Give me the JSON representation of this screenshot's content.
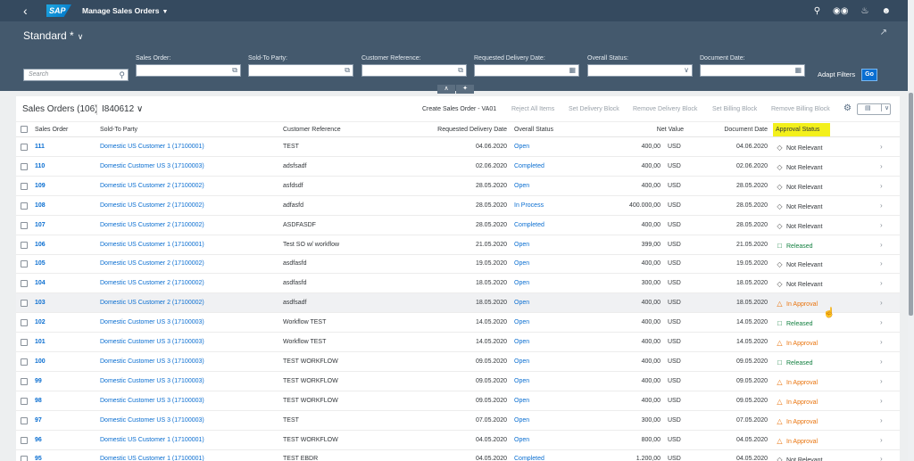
{
  "shell": {
    "logo": "SAP",
    "app_title": "Manage Sales Orders",
    "icons": [
      "search-icon",
      "binoculars-icon",
      "bell-icon",
      "user-icon"
    ]
  },
  "header": {
    "variant": "Standard *",
    "search_placeholder": "Search",
    "filters": [
      {
        "label": "Sales Order:"
      },
      {
        "label": "Sold-To Party:"
      },
      {
        "label": "Customer Reference:"
      },
      {
        "label": "Requested Delivery Date:"
      },
      {
        "label": "Overall Status:"
      },
      {
        "label": "Document Date:"
      }
    ],
    "adapt_filters": "Adapt Filters",
    "go": "Go"
  },
  "table": {
    "title": "Sales Orders (106)",
    "variant": "I840612",
    "actions": [
      {
        "label": "Create Sales Order - VA01",
        "enabled": true
      },
      {
        "label": "Reject All Items",
        "enabled": false
      },
      {
        "label": "Set Delivery Block",
        "enabled": false
      },
      {
        "label": "Remove Delivery Block",
        "enabled": false
      },
      {
        "label": "Set Billing Block",
        "enabled": false
      },
      {
        "label": "Remove Billing Block",
        "enabled": false
      }
    ],
    "columns": {
      "sales_order": "Sales Order",
      "sold_to": "Sold-To Party",
      "cust_ref": "Customer Reference",
      "req_date": "Requested Delivery Date",
      "overall": "Overall Status",
      "net_value": "Net Value",
      "doc_date": "Document Date",
      "approval": "Approval Status"
    },
    "rows": [
      {
        "so": "111",
        "party": "Domestic US Customer 1 (17100001)",
        "ref": "TEST",
        "req": "04.06.2020",
        "overall": "Open",
        "net": "400,00",
        "cur": "USD",
        "doc": "04.06.2020",
        "approval": "Not Relevant",
        "atype": "nr"
      },
      {
        "so": "110",
        "party": "Domestic Customer US 3 (17100003)",
        "ref": "adsfsadf",
        "req": "02.06.2020",
        "overall": "Completed",
        "net": "400,00",
        "cur": "USD",
        "doc": "02.06.2020",
        "approval": "Not Relevant",
        "atype": "nr"
      },
      {
        "so": "109",
        "party": "Domestic US Customer 2 (17100002)",
        "ref": "asfdsdf",
        "req": "28.05.2020",
        "overall": "Open",
        "net": "400,00",
        "cur": "USD",
        "doc": "28.05.2020",
        "approval": "Not Relevant",
        "atype": "nr"
      },
      {
        "so": "108",
        "party": "Domestic US Customer 2 (17100002)",
        "ref": "adfasfd",
        "req": "28.05.2020",
        "overall": "In Process",
        "net": "400.000,00",
        "cur": "USD",
        "doc": "28.05.2020",
        "approval": "Not Relevant",
        "atype": "nr"
      },
      {
        "so": "107",
        "party": "Domestic US Customer 2 (17100002)",
        "ref": "ASDFASDF",
        "req": "28.05.2020",
        "overall": "Completed",
        "net": "400,00",
        "cur": "USD",
        "doc": "28.05.2020",
        "approval": "Not Relevant",
        "atype": "nr"
      },
      {
        "so": "106",
        "party": "Domestic US Customer 1 (17100001)",
        "ref": "Test SO w/ workflow",
        "req": "21.05.2020",
        "overall": "Open",
        "net": "399,00",
        "cur": "USD",
        "doc": "21.05.2020",
        "approval": "Released",
        "atype": "rel"
      },
      {
        "so": "105",
        "party": "Domestic US Customer 2 (17100002)",
        "ref": "asdfasfd",
        "req": "19.05.2020",
        "overall": "Open",
        "net": "400,00",
        "cur": "USD",
        "doc": "19.05.2020",
        "approval": "Not Relevant",
        "atype": "nr"
      },
      {
        "so": "104",
        "party": "Domestic US Customer 2 (17100002)",
        "ref": "asdfasfd",
        "req": "18.05.2020",
        "overall": "Open",
        "net": "300,00",
        "cur": "USD",
        "doc": "18.05.2020",
        "approval": "Not Relevant",
        "atype": "nr"
      },
      {
        "so": "103",
        "party": "Domestic US Customer 2 (17100002)",
        "ref": "asdfsadf",
        "req": "18.05.2020",
        "overall": "Open",
        "net": "400,00",
        "cur": "USD",
        "doc": "18.05.2020",
        "approval": "In Approval",
        "atype": "apr"
      },
      {
        "so": "102",
        "party": "Domestic Customer US 3 (17100003)",
        "ref": "Workflow TEST",
        "req": "14.05.2020",
        "overall": "Open",
        "net": "400,00",
        "cur": "USD",
        "doc": "14.05.2020",
        "approval": "Released",
        "atype": "rel"
      },
      {
        "so": "101",
        "party": "Domestic Customer US 3 (17100003)",
        "ref": "Workflow TEST",
        "req": "14.05.2020",
        "overall": "Open",
        "net": "400,00",
        "cur": "USD",
        "doc": "14.05.2020",
        "approval": "In Approval",
        "atype": "apr"
      },
      {
        "so": "100",
        "party": "Domestic Customer US 3 (17100003)",
        "ref": "TEST WORKFLOW",
        "req": "09.05.2020",
        "overall": "Open",
        "net": "400,00",
        "cur": "USD",
        "doc": "09.05.2020",
        "approval": "Released",
        "atype": "rel"
      },
      {
        "so": "99",
        "party": "Domestic Customer US 3 (17100003)",
        "ref": "TEST WORKFLOW",
        "req": "09.05.2020",
        "overall": "Open",
        "net": "400,00",
        "cur": "USD",
        "doc": "09.05.2020",
        "approval": "In Approval",
        "atype": "apr"
      },
      {
        "so": "98",
        "party": "Domestic Customer US 3 (17100003)",
        "ref": "TEST WORKFLOW",
        "req": "09.05.2020",
        "overall": "Open",
        "net": "400,00",
        "cur": "USD",
        "doc": "09.05.2020",
        "approval": "In Approval",
        "atype": "apr"
      },
      {
        "so": "97",
        "party": "Domestic Customer US 3 (17100003)",
        "ref": "TEST",
        "req": "07.05.2020",
        "overall": "Open",
        "net": "300,00",
        "cur": "USD",
        "doc": "07.05.2020",
        "approval": "In Approval",
        "atype": "apr"
      },
      {
        "so": "96",
        "party": "Domestic US Customer 1 (17100001)",
        "ref": "TEST WORKFLOW",
        "req": "04.05.2020",
        "overall": "Open",
        "net": "800,00",
        "cur": "USD",
        "doc": "04.05.2020",
        "approval": "In Approval",
        "atype": "apr"
      },
      {
        "so": "95",
        "party": "Domestic US Customer 1 (17100001)",
        "ref": "TEST EBDR",
        "req": "04.05.2020",
        "overall": "Completed",
        "net": "1.200,00",
        "cur": "USD",
        "doc": "04.05.2020",
        "approval": "Not Relevant",
        "atype": "nr"
      }
    ],
    "highlighted_row": 8
  }
}
